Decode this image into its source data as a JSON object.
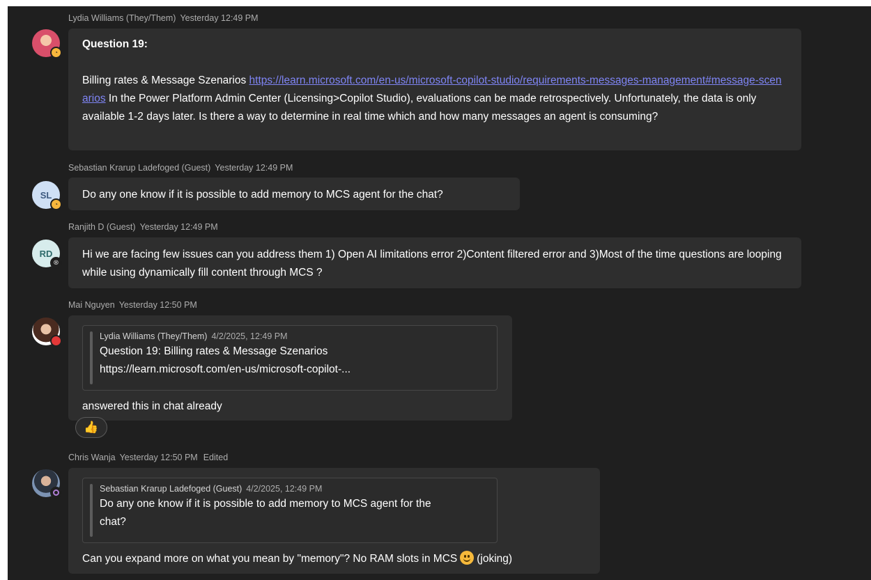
{
  "messages": [
    {
      "author": "Lydia Williams (They/Them)",
      "time": "Yesterday 12:49 PM",
      "title": "Question 19:",
      "text_before_link": "Billing rates & Message Szenarios ",
      "link": "https://learn.microsoft.com/en-us/microsoft-copilot-studio/requirements-messages-management#message-scenarios",
      "text_after_link": " In the Power Platform Admin Center (Licensing>Copilot Studio), evaluations can be made retrospectively. Unfortunately, the data is only available 1-2 days later. Is there a way to determine in real time which and how many messages an agent is consuming?",
      "avatar_color": "#d94f6a",
      "status": "away"
    },
    {
      "author": "Sebastian Krarup Ladefoged (Guest)",
      "time": "Yesterday 12:49 PM",
      "initials": "SL",
      "text": "Do any one know if it is possible to add memory to MCS agent for the chat?",
      "avatar_color": "#cfe0f5",
      "status": "away"
    },
    {
      "author": "Ranjith D (Guest)",
      "time": "Yesterday 12:49 PM",
      "initials": "RD",
      "text": "Hi we are facing few issues can you address them 1) Open AI limitations error 2)Content filtered error and 3)Most of the time questions are looping while using dynamically fill content through MCS ?",
      "avatar_color": "#d7ecec",
      "status": "offline"
    },
    {
      "author": "Mai Nguyen",
      "time": "Yesterday 12:50 PM",
      "quote": {
        "author": "Lydia Williams (They/Them)",
        "date": "4/2/2025, 12:49 PM",
        "line1": "Question 19: Billing rates & Message Szenarios",
        "line2": "https://learn.microsoft.com/en-us/microsoft-copilot-..."
      },
      "text": "answered this in chat already",
      "reaction": "👍",
      "avatar_color": "#8a5a44",
      "status": "busy"
    },
    {
      "author": "Chris Wanja",
      "time": "Yesterday 12:50 PM",
      "edited": "Edited",
      "quote": {
        "author": "Sebastian Krarup Ladefoged (Guest)",
        "date": "4/2/2025, 12:49 PM",
        "line1": "Do any one know if it is possible to add memory to MCS agent for the",
        "line2": "chat?"
      },
      "text_before_emoji": "Can you expand more on what you mean by \"memory\"? No RAM slots in MCS",
      "text_after_emoji": "(joking)",
      "avatar_color": "#5a6f8c",
      "status": "dnd-purple"
    }
  ],
  "colors": {
    "background": "#1f1f1f",
    "bubble": "#2e2e2e",
    "link": "#7f85f5",
    "meta": "#adadad",
    "away": "#f8b73d",
    "busy": "#e33838",
    "purple": "#b07fd6"
  }
}
